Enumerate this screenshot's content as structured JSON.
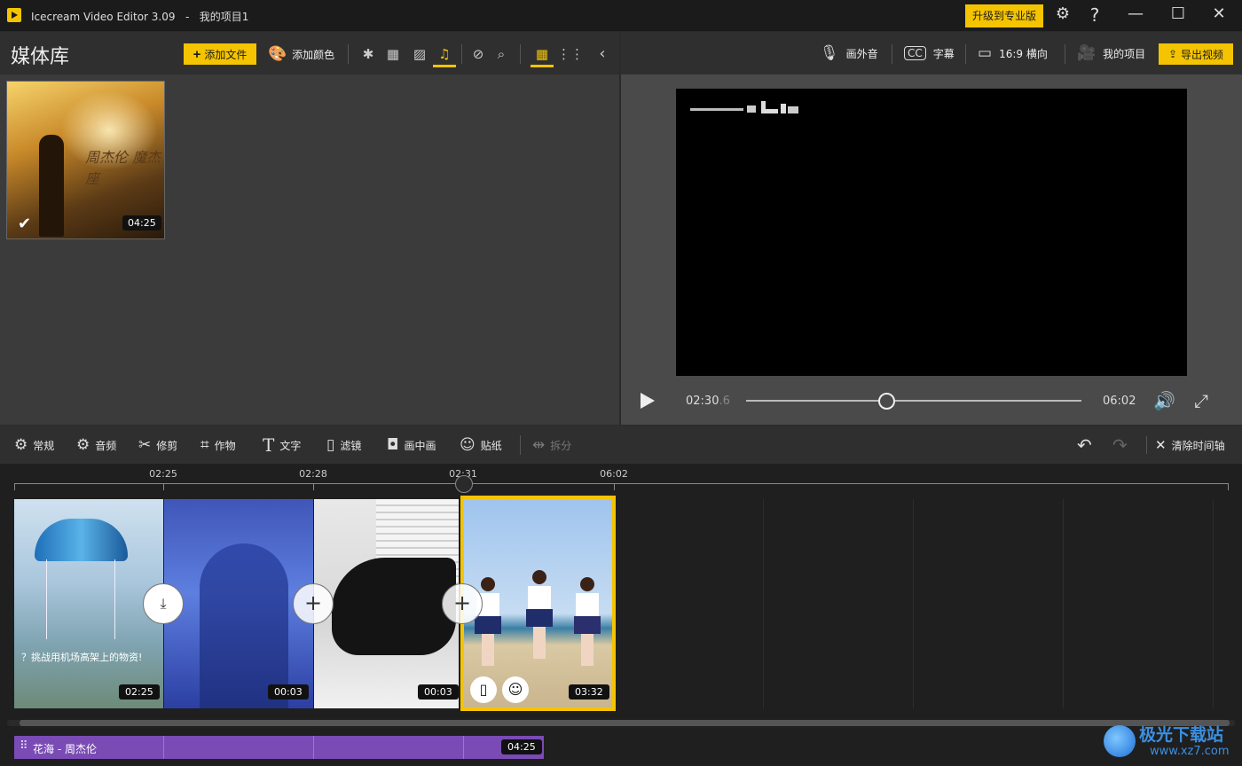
{
  "titlebar": {
    "app_title": "Icecream Video Editor 3.09   -   我的项目1",
    "upgrade_label": "升级到专业版"
  },
  "media_library": {
    "title": "媒体库",
    "add_file_label": "添加文件",
    "add_color_label": "添加颜色",
    "active_filter": "music",
    "items": [
      {
        "thumb_text": "周杰伦 魔杰座",
        "duration": "04:25",
        "selected": true
      }
    ]
  },
  "preview": {
    "toolbar": {
      "voiceover_label": "画外音",
      "subtitles_label": "字幕",
      "aspect_label": "16:9 横向",
      "projects_label": "我的项目",
      "export_label": "导出视频"
    },
    "current_time": "02:30",
    "current_time_fraction": ".6",
    "total_time": "06:02",
    "progress": 0.42
  },
  "edit_toolbar": {
    "general_label": "常规",
    "audio_label": "音频",
    "trim_label": "修剪",
    "crop_label": "作物",
    "text_label": "文字",
    "filter_label": "滤镜",
    "pip_label": "画中画",
    "sticker_label": "贴纸",
    "split_label": "拆分",
    "clear_timeline_label": "清除时间轴"
  },
  "timeline": {
    "ruler_labels": [
      "02:25",
      "02:28",
      "02:31",
      "06:02"
    ],
    "clips": [
      {
        "duration": "02:25",
        "caption": "？挑战用机场高架上的物资!"
      },
      {
        "duration": "00:03"
      },
      {
        "duration": "00:03"
      },
      {
        "duration": "03:32",
        "selected": true
      }
    ],
    "audio_track": {
      "label": "花海 - 周杰伦",
      "duration": "04:25"
    }
  },
  "watermark": {
    "name": "极光下载站",
    "url": "www.xz7.com"
  },
  "colors": {
    "accent": "#f5c400",
    "audio_track": "#7a4bb5"
  }
}
